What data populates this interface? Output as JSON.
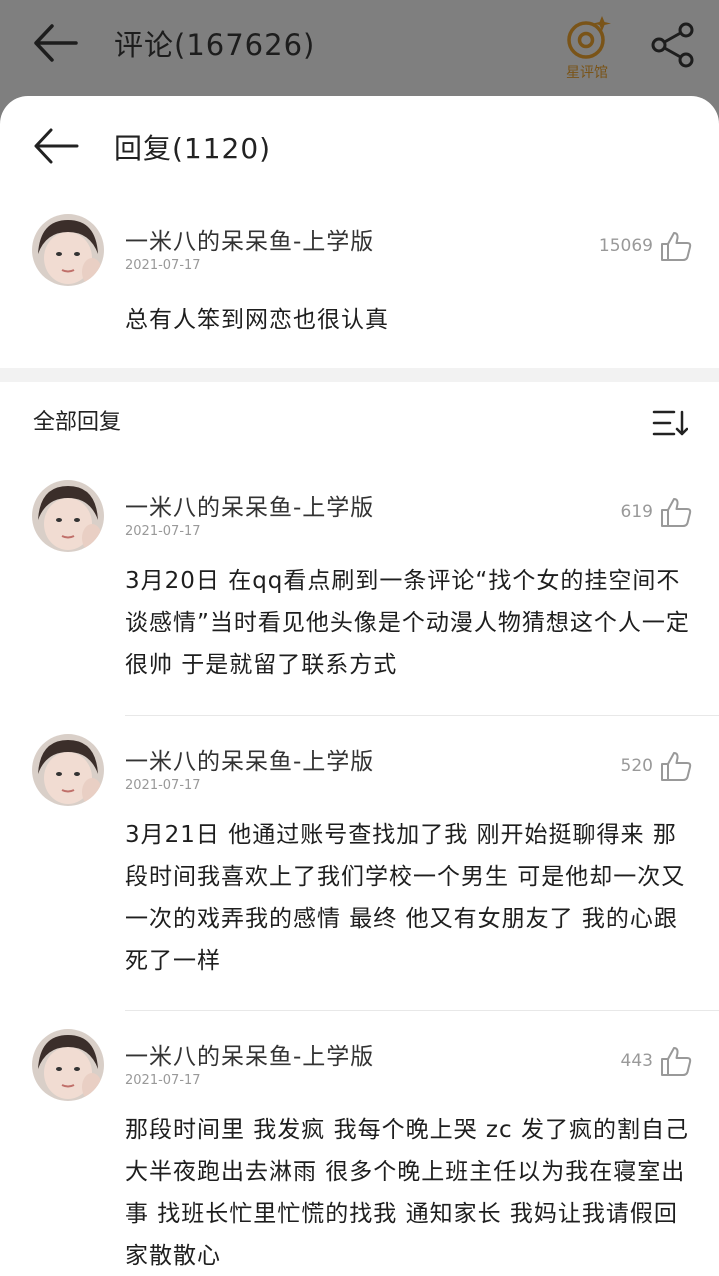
{
  "topbar": {
    "title": "评论(167626)",
    "star_hall_label": "星评馆"
  },
  "sheet": {
    "title": "回复(1120)",
    "section_title": "全部回复"
  },
  "main_comment": {
    "user": "一米八的呆呆鱼-上学版",
    "date": "2021-07-17",
    "likes": "15069",
    "text": "总有人笨到网恋也很认真"
  },
  "replies": [
    {
      "user": "一米八的呆呆鱼-上学版",
      "date": "2021-07-17",
      "likes": "619",
      "text": "3月20日 在qq看点刷到一条评论“找个女的挂空间不谈感情”当时看见他头像是个动漫人物猜想这个人一定很帅 于是就留了联系方式"
    },
    {
      "user": "一米八的呆呆鱼-上学版",
      "date": "2021-07-17",
      "likes": "520",
      "text": "3月21日 他通过账号查找加了我 刚开始挺聊得来 那段时间我喜欢上了我们学校一个男生 可是他却一次又一次的戏弄我的感情 最终 他又有女朋友了 我的心跟死了一样"
    },
    {
      "user": "一米八的呆呆鱼-上学版",
      "date": "2021-07-17",
      "likes": "443",
      "text": "那段时间里 我发疯 我每个晚上哭 zc 发了疯的割自己 大半夜跑出去淋雨 很多个晚上班主任以为我在寝室出事 找班长忙里忙慌的找我 通知家长 我妈让我请假回家散散心"
    }
  ],
  "colors": {
    "overlay": "#7f7f7f",
    "accent": "#7a5418",
    "gap": "#f2f2f2"
  }
}
